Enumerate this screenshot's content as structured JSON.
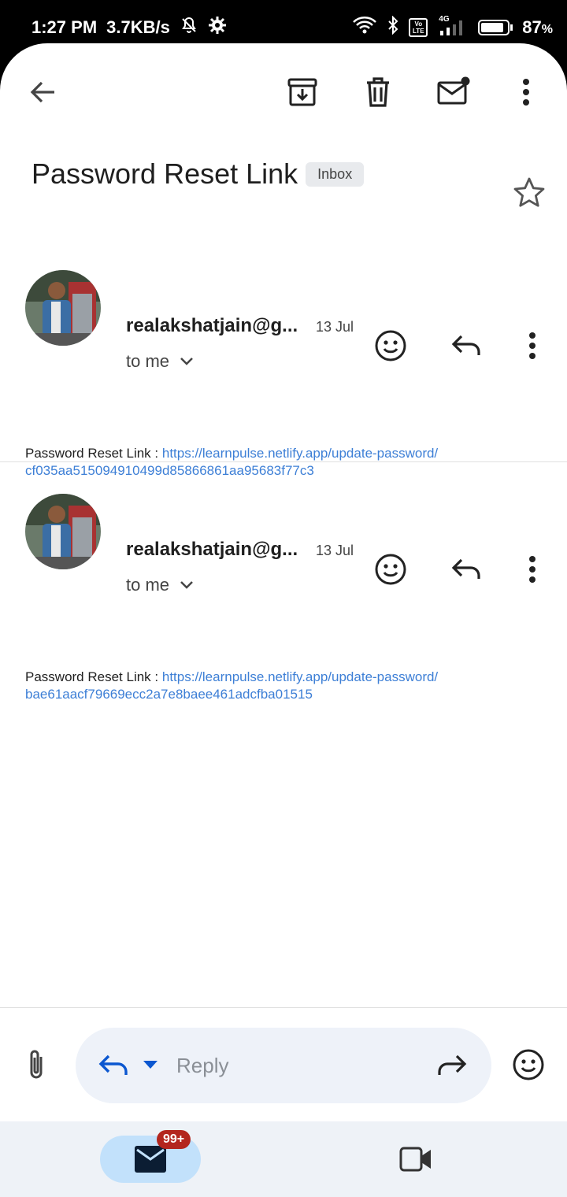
{
  "status_bar": {
    "time": "1:27 PM",
    "speed": "3.7KB/s",
    "volte": "Vo LTE",
    "network": "4G",
    "battery_pct": "87",
    "battery_unit": "%",
    "battery_level": 87
  },
  "toolbar": {
    "back_icon": "arrow-back-icon",
    "archive_icon": "archive-icon",
    "delete_icon": "trash-icon",
    "mark_unread_icon": "mail-unread-icon",
    "more_icon": "more-vert-icon"
  },
  "email": {
    "subject": "Password Reset Link",
    "label": "Inbox"
  },
  "messages": [
    {
      "sender": "realakshatjain@g...",
      "date": "13 Jul",
      "recipient": "to me",
      "body_label": "Password Reset Link :",
      "link_line1": "https://learnpulse.netlify.app/update-password/",
      "link_line2": "cf035aa515094910499d85866861aa95683f77c3"
    },
    {
      "sender": "realakshatjain@g...",
      "date": "13 Jul",
      "recipient": "to me",
      "body_label": "Password Reset Link :",
      "link_line1": "https://learnpulse.netlify.app/update-password/",
      "link_line2": "bae61aacf79669ecc2a7e8baee461adcfba01515"
    }
  ],
  "reply_bar": {
    "placeholder": "Reply"
  },
  "bottom_nav": {
    "mail_badge": "99+"
  },
  "colors": {
    "accent_blue": "#0b57d0",
    "link_blue": "#3d7fd6",
    "badge_red": "#b3261e"
  }
}
